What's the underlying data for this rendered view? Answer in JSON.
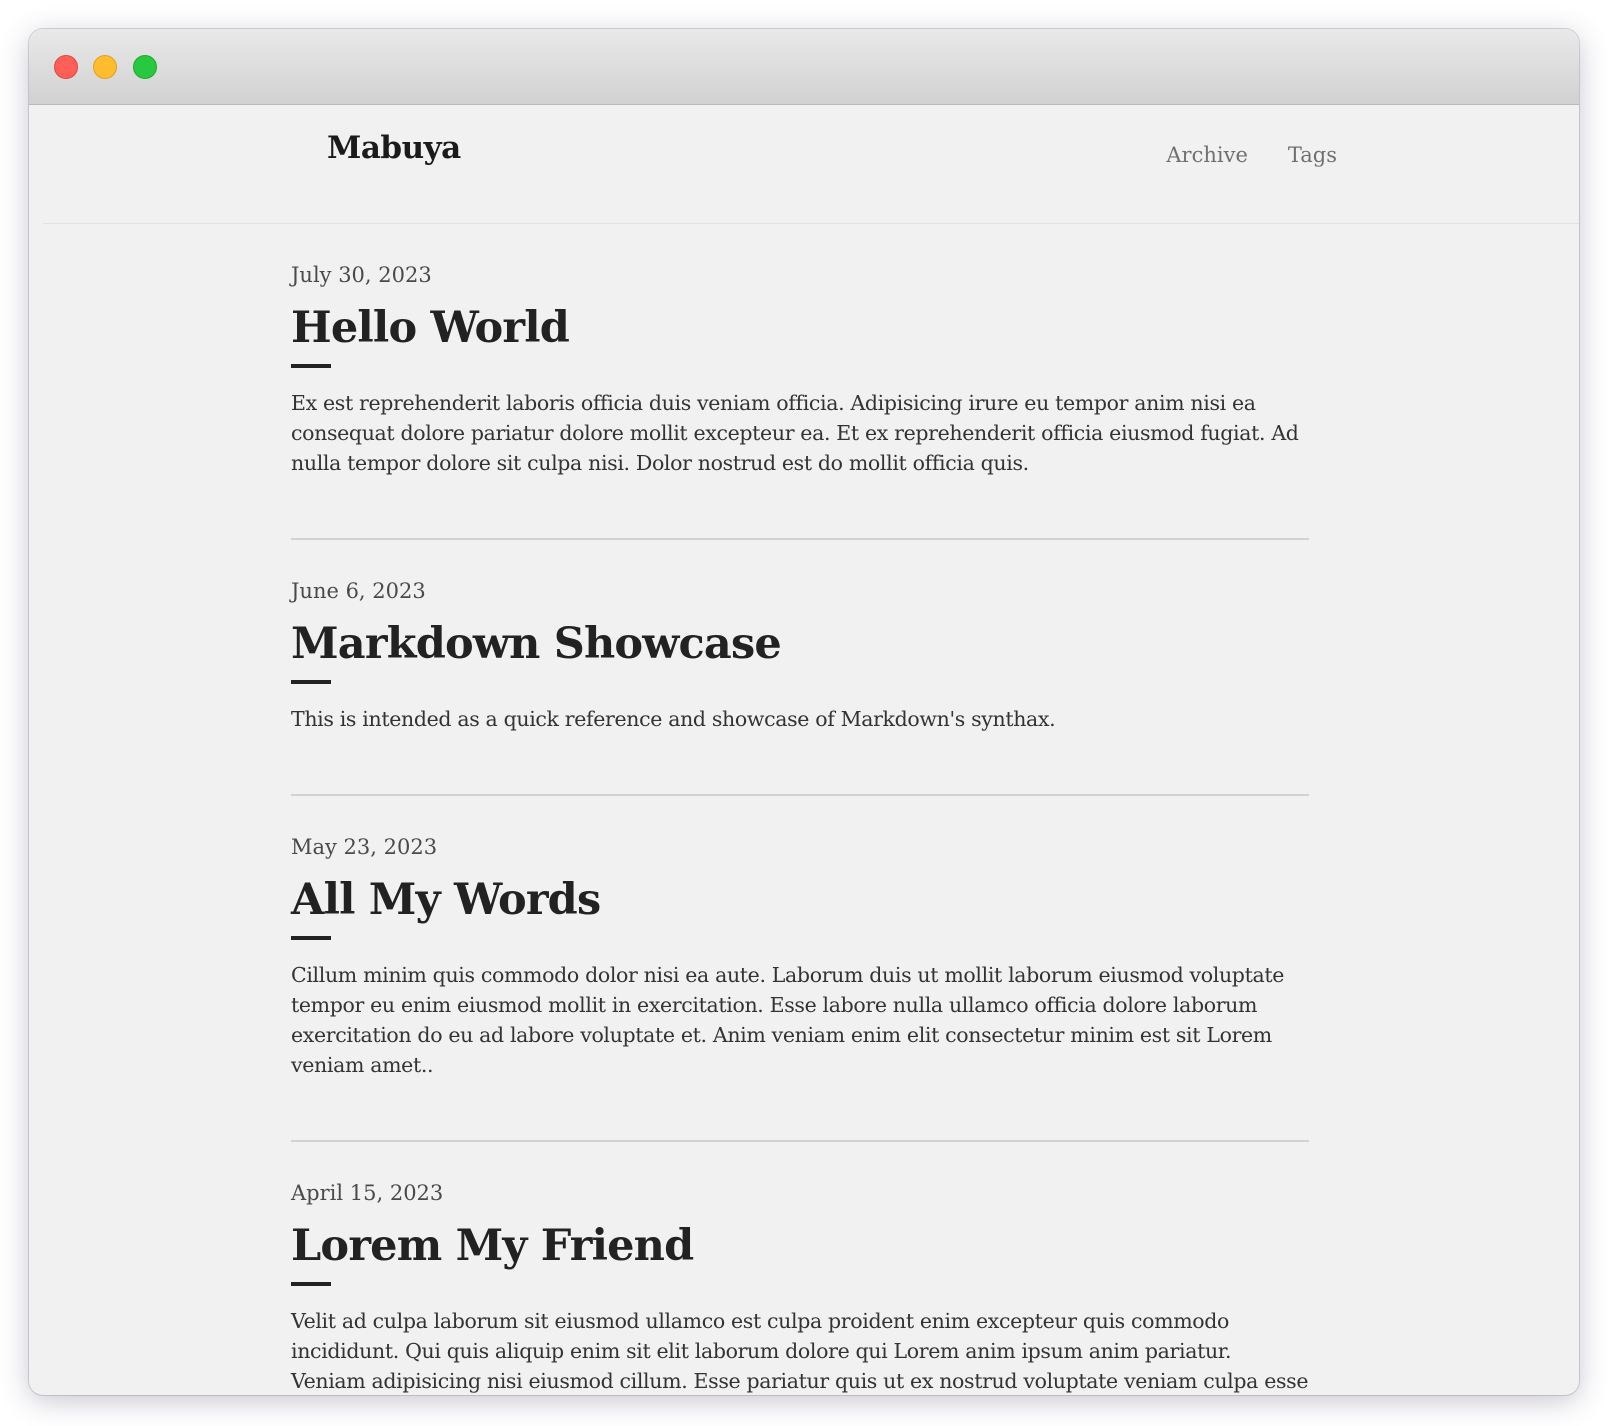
{
  "site": {
    "title": "Mabuya"
  },
  "nav": {
    "items": [
      {
        "label": "Archive"
      },
      {
        "label": "Tags"
      }
    ]
  },
  "posts": [
    {
      "date": "July 30, 2023",
      "title": "Hello World",
      "excerpt": "Ex est reprehenderit laboris officia duis veniam officia. Adipisicing irure eu tempor anim nisi ea consequat dolore pariatur dolore mollit excepteur ea. Et ex reprehenderit officia eiusmod fugiat. Ad nulla tempor dolore sit culpa nisi. Dolor nostrud est do mollit officia quis."
    },
    {
      "date": "June 6, 2023",
      "title": "Markdown Showcase",
      "excerpt": "This is intended as a quick reference and showcase of Markdown's synthax."
    },
    {
      "date": "May 23, 2023",
      "title": "All My Words",
      "excerpt": "Cillum minim quis commodo dolor nisi ea aute. Laborum duis ut mollit laborum eiusmod voluptate tempor eu enim eiusmod mollit in exercitation. Esse labore nulla ullamco officia dolore laborum exercitation do eu ad labore voluptate et. Anim veniam enim elit consectetur minim est sit Lorem veniam amet.."
    },
    {
      "date": "April 15, 2023",
      "title": "Lorem My Friend",
      "excerpt": "Velit ad culpa laborum sit eiusmod ullamco est culpa proident enim excepteur quis commodo incididunt. Qui quis aliquip enim sit elit laborum dolore qui Lorem anim ipsum anim pariatur. Veniam adipisicing nisi eiusmod cillum. Esse pariatur quis ut ex nostrud voluptate veniam culpa esse veniam."
    }
  ],
  "window_controls": {
    "close_color": "#fe5f57",
    "minimize_color": "#febc2e",
    "maximize_color": "#28c840"
  }
}
